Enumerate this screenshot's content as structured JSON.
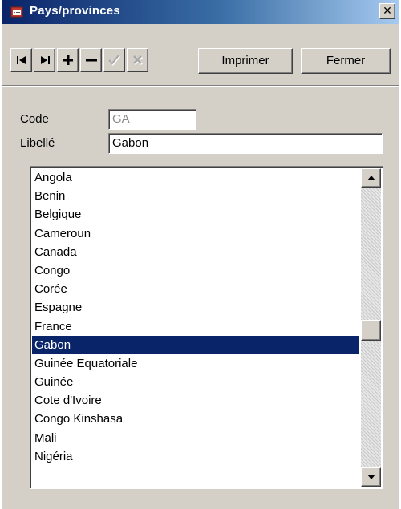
{
  "window": {
    "title": "Pays/provinces",
    "close_glyph": "✕"
  },
  "toolbar": {
    "buttons": [
      {
        "name": "first-record-icon",
        "enabled": true
      },
      {
        "name": "last-record-icon",
        "enabled": true
      },
      {
        "name": "add-icon",
        "enabled": true
      },
      {
        "name": "delete-icon",
        "enabled": true
      },
      {
        "name": "validate-icon",
        "enabled": false
      },
      {
        "name": "cancel-icon",
        "enabled": false
      }
    ],
    "print_label": "Imprimer",
    "close_label": "Fermer"
  },
  "form": {
    "code_label": "Code",
    "code_value": "GA",
    "libelle_label": "Libellé",
    "libelle_value": "Gabon"
  },
  "list": {
    "items": [
      "Angola",
      "Benin",
      "Belgique",
      "Cameroun",
      "Canada",
      "Congo",
      "Corée",
      "Espagne",
      "France",
      "Gabon",
      "Guinée Equatoriale",
      "Guinée",
      "Cote d'Ivoire",
      "Congo Kinshasa",
      "Mali",
      "Nigéria"
    ],
    "selected_index": 9
  },
  "colors": {
    "selection": "#0a246a",
    "titlebar_start": "#0a246a",
    "face": "#d4d0c8"
  }
}
